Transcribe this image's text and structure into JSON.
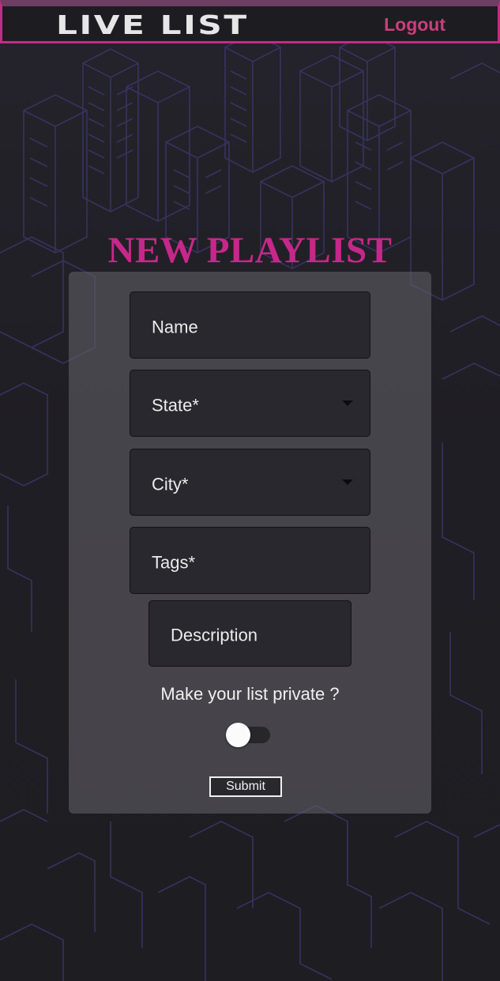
{
  "header": {
    "logo_text": "LIVE LIST",
    "logout_label": "Logout"
  },
  "form": {
    "title": "NEW PLAYLIST",
    "name_label": "Name",
    "state_label": "State*",
    "city_label": "City*",
    "tags_label": "Tags*",
    "description_label": "Description",
    "private_label": "Make your list private ?",
    "private_toggle_on": false,
    "submit_label": "Submit"
  },
  "colors": {
    "accent_pink": "#c6288a",
    "header_border": "#c02d86",
    "logout": "#c7407c",
    "background": "#1f1e23",
    "card": "#5f5e66",
    "field": "#29282e"
  },
  "icons": [
    "chevron-down-icon",
    "chevron-down-icon"
  ]
}
